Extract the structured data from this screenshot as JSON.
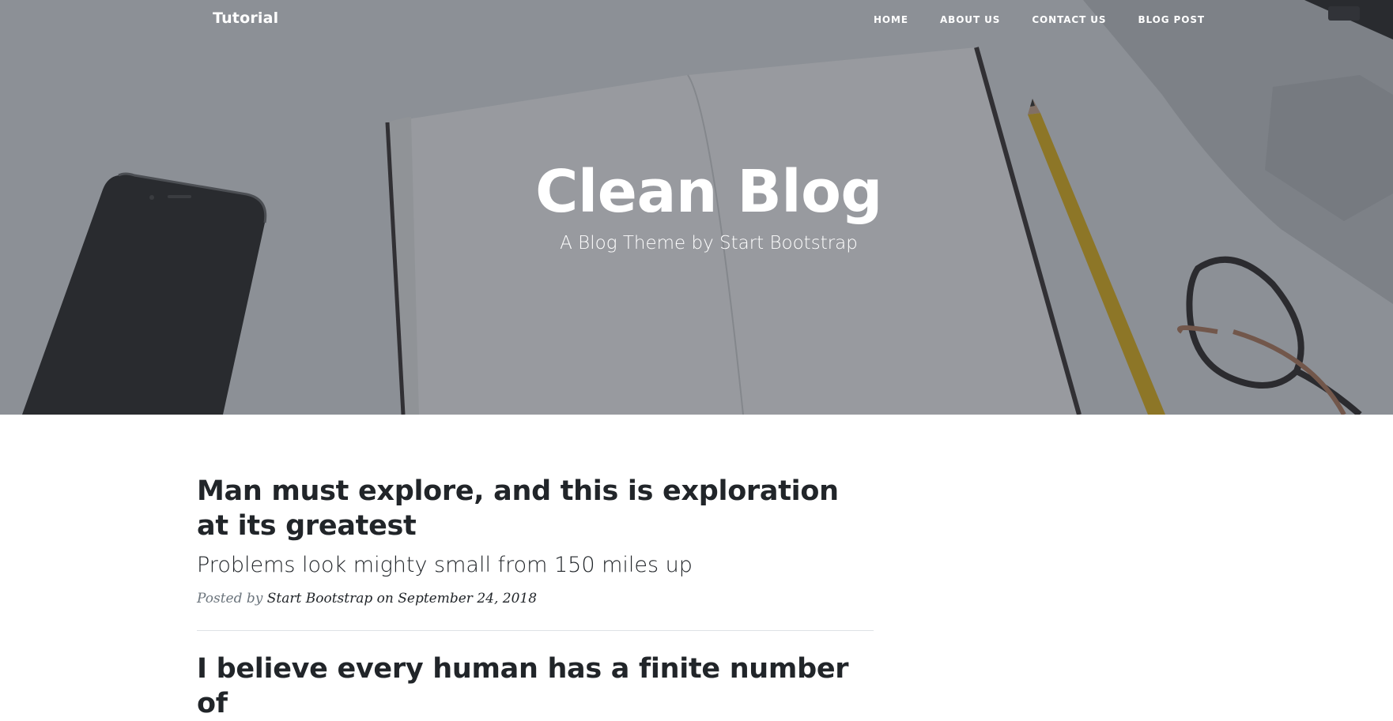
{
  "navbar": {
    "brand": "Tutorial",
    "links": [
      "HOME",
      "ABOUT US",
      "CONTACT US",
      "BLOG POST"
    ]
  },
  "header": {
    "title": "Clean Blog",
    "subtitle": "A Blog Theme by Start Bootstrap"
  },
  "posts": [
    {
      "title": "Man must explore, and this is exploration at its greatest",
      "subtitle": "Problems look mighty small from 150 miles up",
      "meta_prefix": "Posted by",
      "author": "Start Bootstrap",
      "date_text": "on September 24, 2018"
    },
    {
      "title": "I believe every human has a finite number of"
    }
  ],
  "colors": {
    "text_dark": "#212529",
    "text_muted": "#6c757d",
    "divider": "#dee2e6",
    "pencil": "#e0b21e"
  }
}
